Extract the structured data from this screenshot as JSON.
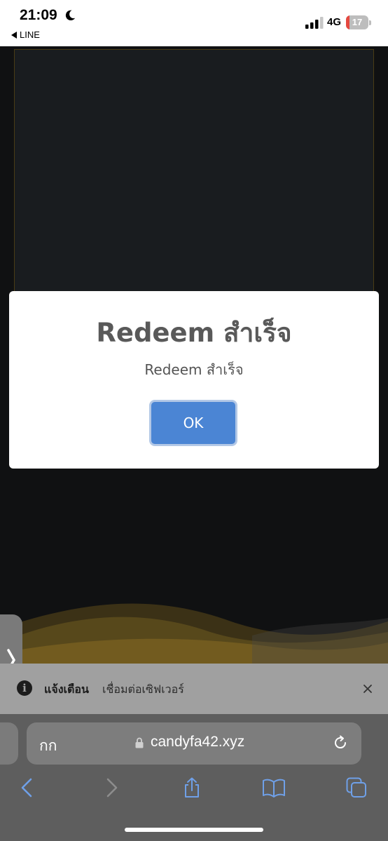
{
  "status_bar": {
    "time": "21:09",
    "back_app": "LINE",
    "network": "4G",
    "battery_level": "17",
    "battery_fraction": 0.17
  },
  "alert": {
    "title": "Redeem สำเร็จ",
    "message": "Redeem สำเร็จ",
    "ok_label": "OK"
  },
  "notice": {
    "title": "แจ้งเตือน",
    "text": "เชื่อมต่อเซิฟเวอร์"
  },
  "browser": {
    "reader_label": "กก",
    "url": "candyfa42.xyz"
  },
  "colors": {
    "accent": "#4b85d4",
    "battery_low": "#e5483f",
    "toolbar_icon": "#6fa0e8"
  },
  "icons": {
    "moon": "moon-icon",
    "signal": "signal-icon",
    "battery": "battery-icon",
    "lock": "lock-icon",
    "reload": "reload-icon",
    "back": "chevron-left-icon",
    "forward": "chevron-right-icon",
    "share": "share-icon",
    "bookmarks": "book-icon",
    "tabs": "tabs-icon",
    "close": "close-icon",
    "info": "info-icon"
  }
}
